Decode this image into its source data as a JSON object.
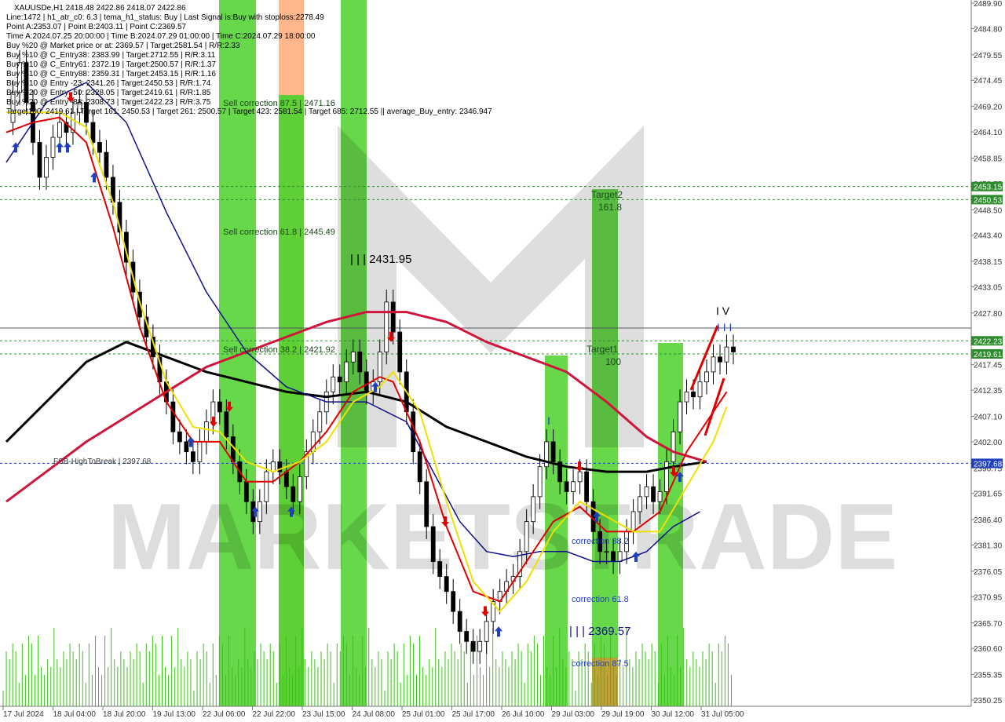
{
  "window": {
    "symbol_line": "XAUUSDe,H1  2418.48 2422.86 2418.07 2422.86"
  },
  "info_lines": [
    "Line:1472 | h1_atr_c0: 6.3 | tema_h1_status: Buy | Last Signal is:Buy with stoploss:2278.49",
    "Point A:2353.07 | Point B:2403.11 | Point C:2369.57",
    "Time A:2024.07.25 20:00:00 | Time B:2024.07.29 01:00:00 | Time C:2024.07.29 18:00:00",
    "Buy %20 @ Market price or at: 2369.57 | Target:2581.54 | R/R:2.33",
    "Buy %10 @ C_Entry38: 2383.99 | Target:2712.55 | R/R:3.11",
    "Buy %10 @ C_Entry61: 2372.19 | Target:2500.57 | R/R:1.37",
    "Buy %10 @ C_Entry88: 2359.31 | Target:2453.15 | R/R:1.16",
    "Buy %10 @ Entry -23: 2341.26 | Target:2450.53 | R/R:1.74",
    "Buy %20 @ Entry -50: 2328.05 | Target:2419.61 | R/R:1.85",
    "Buy %20 @ Entry -88: 2308.73 | Target:2422.23 | R/R:3.75",
    "Target100: 2419.61 | Target 161: 2450.53 | Target 261: 2500.57 | Target 423: 2581.54 | Target 685: 2712.55 || average_Buy_entry: 2346.947"
  ],
  "annotations": {
    "sell_corr_875": "Sell correction 87.5 | 2471.16",
    "sell_corr_618": "Sell correction 61.8 | 2445.49",
    "sell_corr_382": "Sell correction 38.2 | 2421.92",
    "wave_iii_high": "| | | 2431.95",
    "wave_iii_low": "| | | 2369.57",
    "target2": "Target2",
    "target2_val": "161.8",
    "target1": "Target1",
    "target1_val": "100",
    "correction_382": "correction 38.2",
    "correction_618": "correction 61.8",
    "correction_875": "correction 87.5",
    "fsb_label": "FSB-HighToBreak | 2397.68",
    "wave_iv": "I V",
    "wave_iii_top": "I I I",
    "wave_i": "I"
  },
  "price_tags": [
    {
      "text": "2453.15",
      "value": 2453.15,
      "color": "#2e8b2e"
    },
    {
      "text": "2450.53",
      "value": 2450.53,
      "color": "#2e8b2e"
    },
    {
      "text": "2422.23",
      "value": 2422.23,
      "color": "#2e8b2e"
    },
    {
      "text": "2419.61",
      "value": 2419.61,
      "color": "#2e8b2e"
    },
    {
      "text": "2397.68",
      "value": 2397.68,
      "color": "#1f3fbf"
    }
  ],
  "watermark": "MARKETSTRADE",
  "chart_data": {
    "type": "candlestick",
    "symbol": "XAUUSDe",
    "timeframe": "H1",
    "ylim": [
      2350.25,
      2489.9
    ],
    "y_ticks": [
      "2489.90",
      "2484.80",
      "2479.55",
      "2474.45",
      "2469.20",
      "2464.10",
      "2458.85",
      "2453.75",
      "2448.50",
      "2443.40",
      "2438.15",
      "2433.05",
      "2427.80",
      "2422.70",
      "2417.45",
      "2412.35",
      "2407.10",
      "2402.00",
      "2396.75",
      "2391.65",
      "2386.40",
      "2381.30",
      "2376.05",
      "2370.95",
      "2365.70",
      "2360.60",
      "2355.35",
      "2350.25"
    ],
    "x_ticks": [
      "17 Jul 2024",
      "18 Jul 04:00",
      "18 Jul 20:00",
      "19 Jul 13:00",
      "22 Jul 06:00",
      "22 Jul 22:00",
      "23 Jul 15:00",
      "24 Jul 08:00",
      "25 Jul 01:00",
      "25 Jul 17:00",
      "26 Jul 10:00",
      "29 Jul 03:00",
      "29 Jul 19:00",
      "30 Jul 12:00",
      "31 Jul 05:00"
    ],
    "price_path": [
      [
        0,
        2466
      ],
      [
        1,
        2472
      ],
      [
        2,
        2478
      ],
      [
        3,
        2470
      ],
      [
        4,
        2462
      ],
      [
        5,
        2455
      ],
      [
        6,
        2459
      ],
      [
        7,
        2463
      ],
      [
        8,
        2466
      ],
      [
        9,
        2464
      ],
      [
        10,
        2468
      ],
      [
        11,
        2470
      ],
      [
        12,
        2466
      ],
      [
        13,
        2462
      ],
      [
        14,
        2460
      ],
      [
        15,
        2455
      ],
      [
        16,
        2450
      ],
      [
        17,
        2444
      ],
      [
        18,
        2438
      ],
      [
        19,
        2432
      ],
      [
        20,
        2427
      ],
      [
        21,
        2423
      ],
      [
        22,
        2419
      ],
      [
        23,
        2414
      ],
      [
        24,
        2410
      ],
      [
        25,
        2404
      ],
      [
        26,
        2402
      ],
      [
        27,
        2400
      ],
      [
        28,
        2398
      ],
      [
        29,
        2402
      ],
      [
        30,
        2406
      ],
      [
        31,
        2410
      ],
      [
        32,
        2408
      ],
      [
        33,
        2403
      ],
      [
        34,
        2398
      ],
      [
        35,
        2394
      ],
      [
        36,
        2390
      ],
      [
        37,
        2386
      ],
      [
        38,
        2390
      ],
      [
        39,
        2396
      ],
      [
        40,
        2398
      ],
      [
        41,
        2396
      ],
      [
        42,
        2393
      ],
      [
        43,
        2390
      ],
      [
        44,
        2395
      ],
      [
        45,
        2400
      ],
      [
        46,
        2404
      ],
      [
        47,
        2408
      ],
      [
        48,
        2412
      ],
      [
        49,
        2415
      ],
      [
        50,
        2414
      ],
      [
        51,
        2418
      ],
      [
        52,
        2420
      ],
      [
        53,
        2416
      ],
      [
        54,
        2412
      ],
      [
        55,
        2414
      ],
      [
        56,
        2420
      ],
      [
        57,
        2430
      ],
      [
        58,
        2424
      ],
      [
        59,
        2416
      ],
      [
        60,
        2408
      ],
      [
        61,
        2400
      ],
      [
        62,
        2394
      ],
      [
        63,
        2385
      ],
      [
        64,
        2378
      ],
      [
        65,
        2375
      ],
      [
        66,
        2372
      ],
      [
        67,
        2368
      ],
      [
        68,
        2364
      ],
      [
        69,
        2362
      ],
      [
        70,
        2360
      ],
      [
        71,
        2362
      ],
      [
        72,
        2366
      ],
      [
        73,
        2370
      ],
      [
        74,
        2372
      ],
      [
        75,
        2374
      ],
      [
        76,
        2375
      ],
      [
        77,
        2380
      ],
      [
        78,
        2386
      ],
      [
        79,
        2391
      ],
      [
        80,
        2397
      ],
      [
        81,
        2402
      ],
      [
        82,
        2398
      ],
      [
        83,
        2394
      ],
      [
        84,
        2392
      ],
      [
        85,
        2394
      ],
      [
        86,
        2396
      ],
      [
        87,
        2390
      ],
      [
        88,
        2384
      ],
      [
        89,
        2380
      ],
      [
        90,
        2380
      ],
      [
        91,
        2378
      ],
      [
        92,
        2380
      ],
      [
        93,
        2384
      ],
      [
        94,
        2388
      ],
      [
        95,
        2391
      ],
      [
        96,
        2393
      ],
      [
        97,
        2390
      ],
      [
        98,
        2392
      ],
      [
        99,
        2398
      ],
      [
        100,
        2404
      ],
      [
        101,
        2410
      ],
      [
        102,
        2412
      ],
      [
        103,
        2411
      ],
      [
        104,
        2414
      ],
      [
        105,
        2416
      ],
      [
        106,
        2419
      ],
      [
        107,
        2418
      ],
      [
        108,
        2421
      ],
      [
        109,
        2420
      ]
    ],
    "series": [
      {
        "name": "ma_black",
        "color": "#000000",
        "values": [
          [
            0,
            2402
          ],
          [
            6,
            2410
          ],
          [
            12,
            2418
          ],
          [
            18,
            2422
          ],
          [
            24,
            2419
          ],
          [
            30,
            2416
          ],
          [
            36,
            2414
          ],
          [
            42,
            2412
          ],
          [
            48,
            2411
          ],
          [
            54,
            2412
          ],
          [
            60,
            2410
          ],
          [
            66,
            2405
          ],
          [
            72,
            2402
          ],
          [
            78,
            2399
          ],
          [
            84,
            2397
          ],
          [
            90,
            2396
          ],
          [
            96,
            2396
          ],
          [
            100,
            2397
          ],
          [
            105,
            2398
          ]
        ]
      },
      {
        "name": "ma_crimson",
        "color": "#d0143c",
        "values": [
          [
            0,
            2390
          ],
          [
            6,
            2396
          ],
          [
            12,
            2402
          ],
          [
            18,
            2407
          ],
          [
            24,
            2412
          ],
          [
            30,
            2417
          ],
          [
            36,
            2420
          ],
          [
            42,
            2423
          ],
          [
            48,
            2426
          ],
          [
            54,
            2428
          ],
          [
            60,
            2428
          ],
          [
            66,
            2426
          ],
          [
            72,
            2422
          ],
          [
            78,
            2419
          ],
          [
            84,
            2416
          ],
          [
            90,
            2410
          ],
          [
            96,
            2403
          ],
          [
            100,
            2400
          ],
          [
            105,
            2398
          ]
        ]
      },
      {
        "name": "ma_navy",
        "color": "#10108a",
        "values": [
          [
            0,
            2458
          ],
          [
            6,
            2470
          ],
          [
            12,
            2474
          ],
          [
            18,
            2466
          ],
          [
            24,
            2448
          ],
          [
            30,
            2432
          ],
          [
            36,
            2420
          ],
          [
            42,
            2413
          ],
          [
            48,
            2410
          ],
          [
            54,
            2410
          ],
          [
            60,
            2406
          ],
          [
            64,
            2396
          ],
          [
            68,
            2386
          ],
          [
            72,
            2380
          ],
          [
            76,
            2379
          ],
          [
            80,
            2380
          ],
          [
            84,
            2380
          ],
          [
            88,
            2378
          ],
          [
            92,
            2378
          ],
          [
            96,
            2380
          ],
          [
            100,
            2385
          ],
          [
            104,
            2388
          ]
        ]
      },
      {
        "name": "fast_red",
        "color": "#e00000",
        "values": [
          [
            0,
            2464
          ],
          [
            4,
            2466
          ],
          [
            8,
            2467
          ],
          [
            12,
            2462
          ],
          [
            16,
            2445
          ],
          [
            20,
            2425
          ],
          [
            24,
            2410
          ],
          [
            28,
            2402
          ],
          [
            32,
            2402
          ],
          [
            36,
            2394
          ],
          [
            40,
            2394
          ],
          [
            44,
            2398
          ],
          [
            48,
            2404
          ],
          [
            52,
            2412
          ],
          [
            56,
            2415
          ],
          [
            58,
            2414
          ],
          [
            62,
            2402
          ],
          [
            66,
            2385
          ],
          [
            70,
            2372
          ],
          [
            74,
            2370
          ],
          [
            78,
            2378
          ],
          [
            82,
            2386
          ],
          [
            86,
            2389
          ],
          [
            90,
            2384
          ],
          [
            94,
            2384
          ],
          [
            98,
            2388
          ],
          [
            102,
            2400
          ],
          [
            106,
            2408
          ],
          [
            108,
            2412
          ]
        ]
      },
      {
        "name": "fast_yellow",
        "color": "#f0e000",
        "values": [
          [
            0,
            2468
          ],
          [
            4,
            2468
          ],
          [
            8,
            2468
          ],
          [
            12,
            2465
          ],
          [
            16,
            2450
          ],
          [
            20,
            2430
          ],
          [
            24,
            2414
          ],
          [
            28,
            2405
          ],
          [
            32,
            2404
          ],
          [
            36,
            2398
          ],
          [
            40,
            2396
          ],
          [
            44,
            2398
          ],
          [
            48,
            2402
          ],
          [
            52,
            2410
          ],
          [
            56,
            2413
          ],
          [
            58,
            2416
          ],
          [
            62,
            2408
          ],
          [
            66,
            2390
          ],
          [
            70,
            2374
          ],
          [
            74,
            2368
          ],
          [
            78,
            2374
          ],
          [
            82,
            2384
          ],
          [
            86,
            2390
          ],
          [
            90,
            2387
          ],
          [
            94,
            2384
          ],
          [
            98,
            2384
          ],
          [
            102,
            2393
          ],
          [
            106,
            2402
          ],
          [
            108,
            2409
          ]
        ]
      }
    ]
  }
}
